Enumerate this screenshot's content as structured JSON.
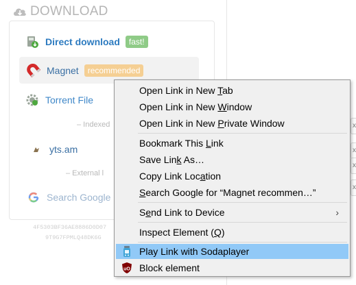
{
  "download_panel": {
    "header": "DOWNLOAD",
    "options": {
      "direct": {
        "label": "Direct download",
        "badge": "fast!"
      },
      "magnet": {
        "label": "Magnet",
        "badge": "recommended"
      },
      "torrent": {
        "label": "Torrent File"
      },
      "yts": {
        "label": "yts.am"
      },
      "google": {
        "label": "Search Google"
      }
    },
    "separators": {
      "indexed": "– Indexed",
      "external": "– External l"
    },
    "hash_line1": "4F5303BF36AE8886D0D07",
    "hash_line2": "9T9G7FPMLQ48DK6G"
  },
  "context_menu": {
    "items": {
      "open_tab": {
        "pre": "Open Link in New ",
        "u": "T",
        "post": "ab"
      },
      "open_window": {
        "pre": "Open Link in New ",
        "u": "W",
        "post": "indow"
      },
      "open_private": {
        "pre": "Open Link in New ",
        "u": "P",
        "post": "rivate Window"
      },
      "bookmark": {
        "pre": "Bookmark This ",
        "u": "L",
        "post": "ink"
      },
      "save": {
        "pre": "Save Lin",
        "u": "k",
        "post": " As…"
      },
      "copy": {
        "pre": "Copy Link Loc",
        "u": "a",
        "post": "tion"
      },
      "search": {
        "pre": "",
        "u": "S",
        "post": "earch Google for “Magnet recommen…”"
      },
      "send": {
        "pre": "S",
        "u": "e",
        "post": "nd Link to Device"
      },
      "inspect": {
        "pre": "Inspect Element (",
        "u": "Q",
        "post": ")"
      },
      "sodaplayer": {
        "label": "Play Link with Sodaplayer"
      },
      "block": {
        "label": "Block element"
      }
    },
    "send_arrow": "›"
  },
  "right_fragments": [
    "x",
    "x",
    "x",
    "x"
  ],
  "colors": {
    "link": "#2d7bc0",
    "badge_fast": "#8fcb87",
    "badge_recommended": "#f5cf93",
    "menu_highlight": "#91c9f7"
  }
}
